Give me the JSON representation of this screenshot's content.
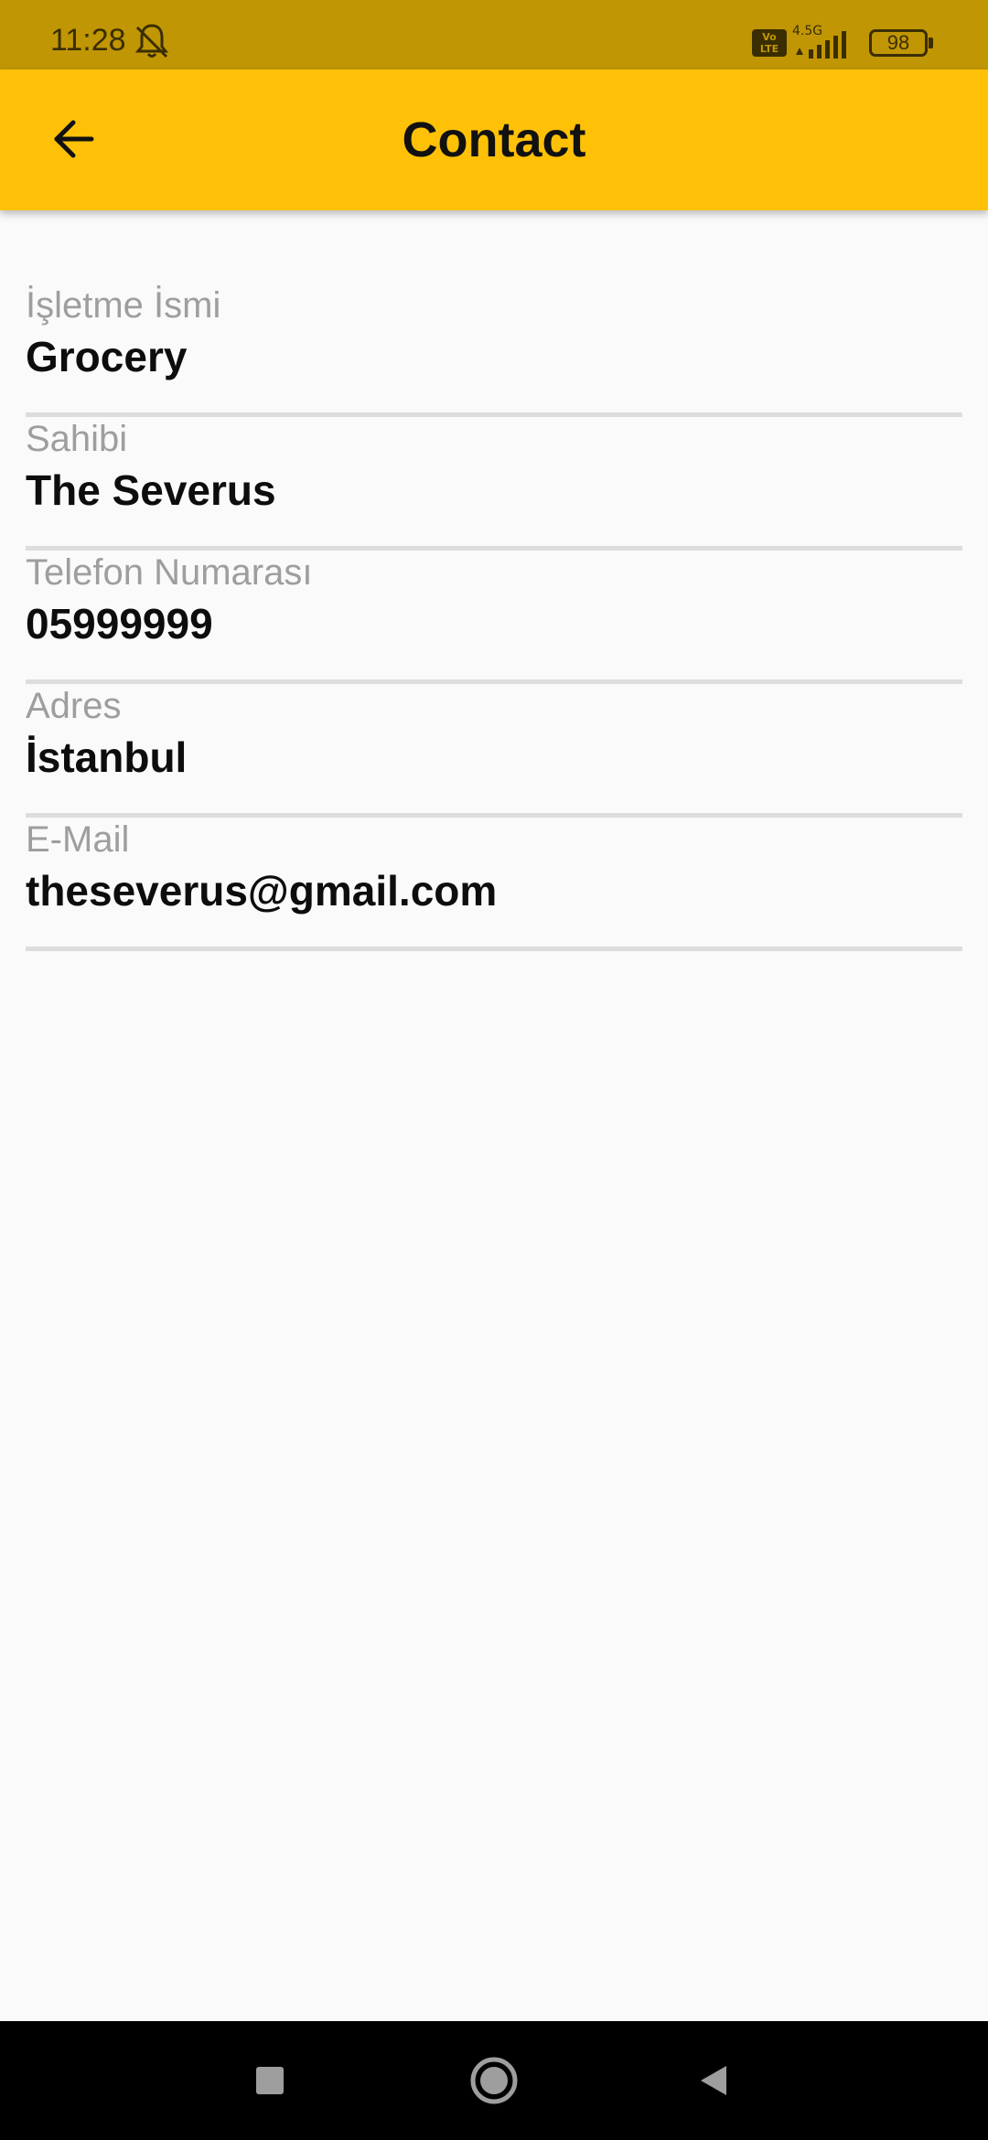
{
  "status_bar": {
    "time": "11:28",
    "network": "4.5G",
    "volte": "Vo LTE",
    "battery": "98"
  },
  "app_bar": {
    "title": "Contact"
  },
  "fields": [
    {
      "label": "İşletme İsmi",
      "value": "Grocery"
    },
    {
      "label": "Sahibi",
      "value": "The Severus"
    },
    {
      "label": "Telefon Numarası",
      "value": "05999999"
    },
    {
      "label": "Adres",
      "value": "İstanbul"
    },
    {
      "label": "E-Mail",
      "value": "theseverus@gmail.com"
    }
  ],
  "colors": {
    "app_bar": "#ffc107",
    "status_bar": "#c19604",
    "background": "#fafafa",
    "label": "#9e9e9e",
    "divider": "#dddddd"
  },
  "icons": {
    "back": "arrow-left-icon",
    "bell": "bell-off-icon",
    "signal": "signal-icon",
    "battery": "battery-icon",
    "nav_recents": "square-icon",
    "nav_home": "circle-icon",
    "nav_back": "triangle-icon"
  }
}
